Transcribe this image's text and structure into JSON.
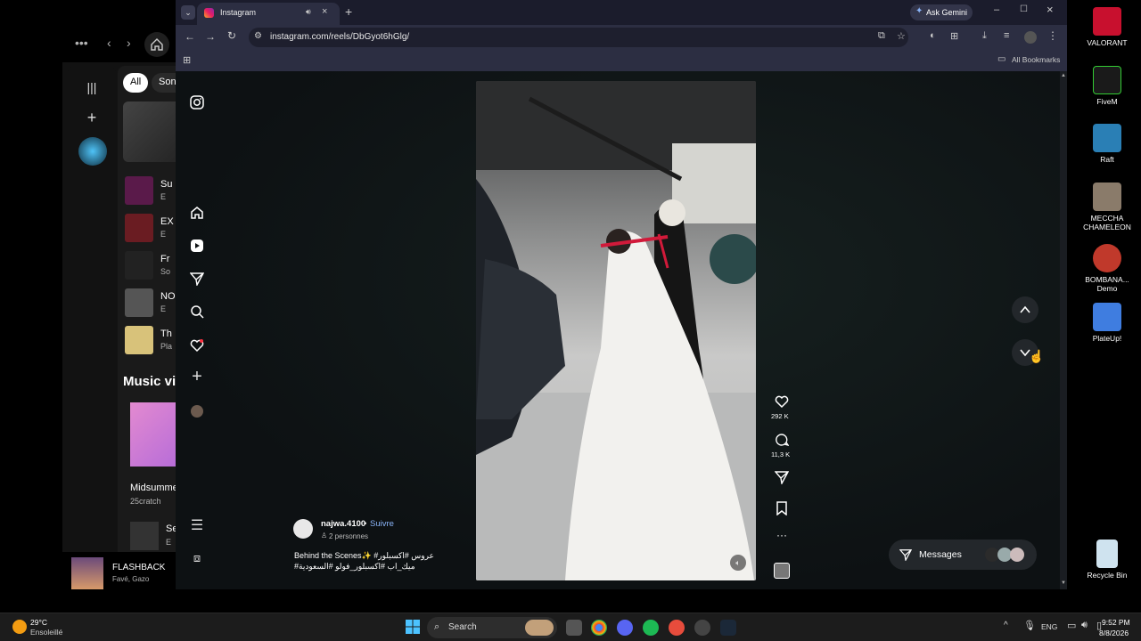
{
  "spotify": {
    "filter_all": "All",
    "filter_songs": "Song",
    "rows": [
      {
        "title": "Su",
        "sub": "E"
      },
      {
        "title": "EX",
        "sub": "E"
      },
      {
        "title": "Fr",
        "sub": "So"
      },
      {
        "title": "NO",
        "sub": "E"
      },
      {
        "title": "Th",
        "sub": "Pla"
      }
    ],
    "section_title": "Music vi",
    "card_title": "Midsumme",
    "card_sub": "25cratch",
    "row_se_title": "Se",
    "row_se_sub": "E",
    "player_title": "FLASHBACK",
    "player_artist": "Favé, Gazo"
  },
  "browser": {
    "tab_title": "Instagram",
    "url": "instagram.com/reels/DbGyot6hGlg/",
    "ask_gemini": "Ask Gemini",
    "all_bookmarks": "All Bookmarks"
  },
  "reel": {
    "username": "najwa.4100",
    "separator": "•",
    "follow": "Suivre",
    "collab": "2 personnes",
    "caption_line1": "Behind the Scenes✨ #عروس #اكسبلور",
    "caption_line2": "#ميك_اب #اكسبلور_فولو #السعودية",
    "likes": "292 K",
    "comments": "11,3 K"
  },
  "messages": {
    "label": "Messages"
  },
  "desktop_icons": [
    {
      "label": "VALORANT",
      "color": "#c8102e"
    },
    {
      "label": "FiveM",
      "color": "#1a1a1a"
    },
    {
      "label": "Raft",
      "color": "#2a7fb5"
    },
    {
      "label": "MECCHA CHAMELEON",
      "color": "#8a7b6a"
    },
    {
      "label": "BOMBANA... Demo",
      "color": "#c0392b"
    },
    {
      "label": "PlateUp!",
      "color": "#3f7de0"
    },
    {
      "label": "Recycle Bin",
      "color": "#cfe3ef"
    }
  ],
  "taskbar": {
    "weather_temp": "29°C",
    "weather_desc": "Ensoleillé",
    "search": "Search",
    "lang": "ENG",
    "time": "9:52 PM",
    "date": "8/8/2026"
  }
}
